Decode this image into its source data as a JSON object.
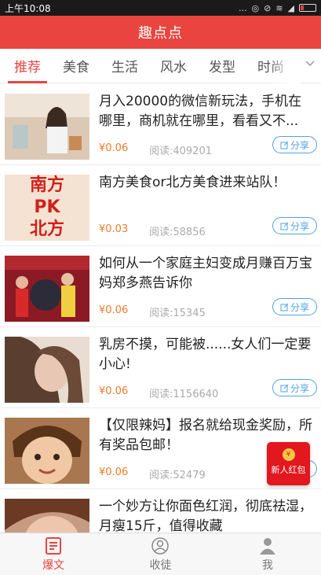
{
  "status_bar": {
    "time": "上午10:08",
    "signal_text": "..."
  },
  "header": {
    "title": "趣点点"
  },
  "tabs": [
    {
      "label": "推荐",
      "active": true
    },
    {
      "label": "美食",
      "active": false
    },
    {
      "label": "生活",
      "active": false
    },
    {
      "label": "风水",
      "active": false
    },
    {
      "label": "发型",
      "active": false
    },
    {
      "label": "时尚",
      "active": false
    }
  ],
  "tab_more_icon": "chevron-down-icon",
  "feed": [
    {
      "title": "月入20000的微信新玩法，手机在哪里，商机就在哪里，看看又不...",
      "price": "¥0.06",
      "reads": "阅读:409201",
      "share": "分享",
      "thumb_color": "#c9a98a",
      "thumb_alt": "woman photo"
    },
    {
      "title": "南方美食or北方美食进来站队！",
      "price": "¥0.03",
      "reads": "阅读:58856",
      "share": "分享",
      "thumb_color": "#f4e2d2",
      "thumb_text_1": "南方",
      "thumb_text_2": "PK",
      "thumb_text_3": "北方"
    },
    {
      "title": "如何从一个家庭主妇变成月赚百万宝妈郑多燕告诉你",
      "price": "¥0.06",
      "reads": "阅读:15345",
      "share": "分享",
      "thumb_color": "#8b1a24",
      "thumb_alt": "event photo"
    },
    {
      "title": "乳房不摸，可能被......女人们一定要小心!",
      "price": "¥0.06",
      "reads": "阅读:1156640",
      "share": "分享",
      "thumb_color": "#d8c4b4",
      "thumb_alt": "woman portrait"
    },
    {
      "title": "【仅限辣妈】报名就给现金奖励，所有奖品包邮！",
      "price": "¥0.06",
      "reads": "阅读:52479",
      "share": "分享",
      "thumb_color": "#8a5a36",
      "thumb_alt": "child portrait"
    },
    {
      "title": "一个妙方让你面色红润，彻底祛湿，月瘦15斤，值得收藏",
      "price": "",
      "reads": "",
      "share": "",
      "thumb_color": "#b98e76",
      "thumb_alt": "woman face"
    }
  ],
  "promo": {
    "label": "新人红包",
    "coin": "¥"
  },
  "bottom_nav": [
    {
      "label": "爆文",
      "icon": "news-icon",
      "active": true
    },
    {
      "label": "收徒",
      "icon": "apprentice-icon",
      "active": false
    },
    {
      "label": "我",
      "icon": "profile-icon",
      "active": false
    }
  ],
  "colors": {
    "brand": "#e9443f",
    "price": "#f07a2a",
    "share": "#4ea1e8"
  }
}
